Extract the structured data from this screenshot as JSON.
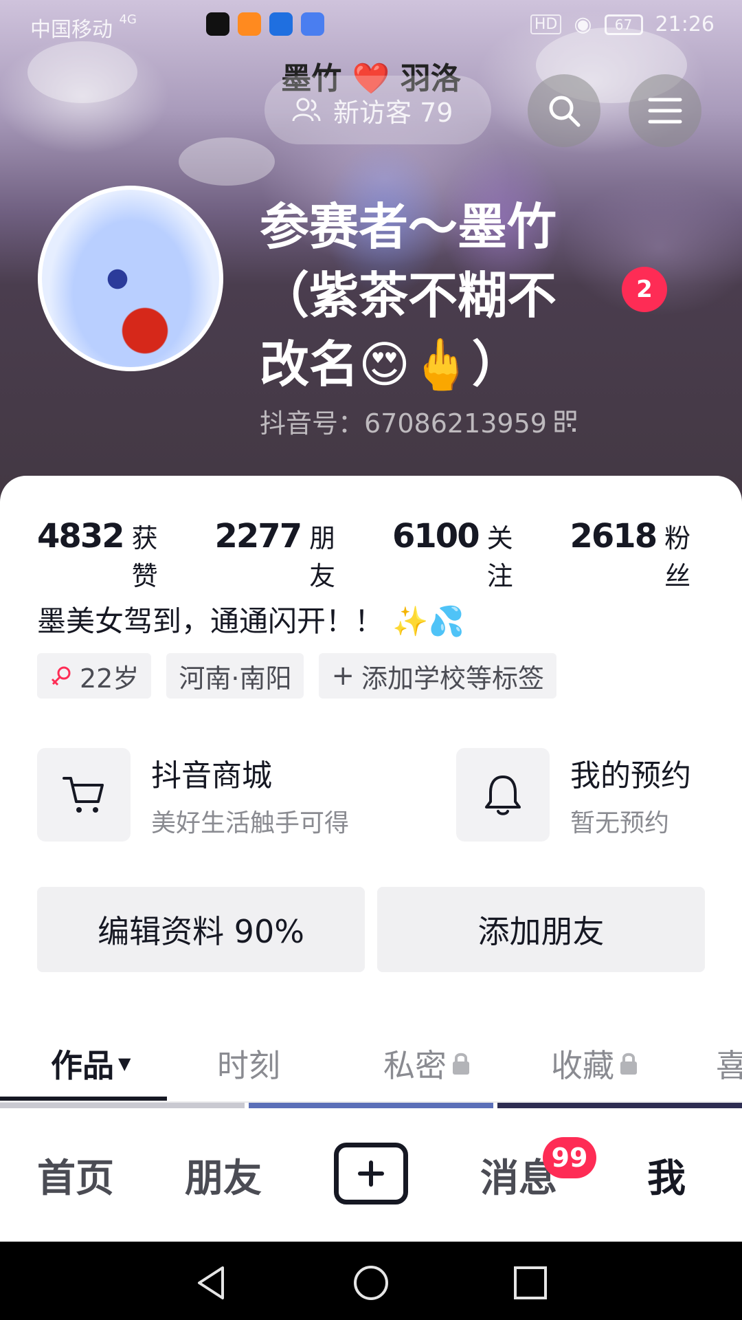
{
  "status_bar": {
    "carrier": "中国移动",
    "network": "4G",
    "battery": "67",
    "time": "21:26"
  },
  "header": {
    "cover_title": "墨竹 ❤️ 羽洛",
    "visitor_label": "新访客 79",
    "search_icon": "search-icon",
    "menu_icon": "menu-icon"
  },
  "profile": {
    "nickname": "参赛者～墨竹（紫茶不糊不改名😍🖕）",
    "notification_count": "2",
    "douyin_id": "抖音号：67086213959"
  },
  "stats": [
    {
      "value": "4832",
      "label": "获赞"
    },
    {
      "value": "2277",
      "label": "朋友"
    },
    {
      "value": "6100",
      "label": "关注"
    },
    {
      "value": "2618",
      "label": "粉丝"
    }
  ],
  "bio": "墨美女驾到，通通闪开！！ ✨💦",
  "tags": {
    "age": "22岁",
    "location": "河南·南阳",
    "add_tag": "添加学校等标签"
  },
  "entries": {
    "mall": {
      "title": "抖音商城",
      "subtitle": "美好生活触手可得"
    },
    "booking": {
      "title": "我的预约",
      "subtitle": "暂无预约"
    }
  },
  "actions": {
    "edit_profile": "编辑资料 90%",
    "add_friend": "添加朋友"
  },
  "tabs": {
    "works": "作品",
    "moments": "时刻",
    "private": "私密",
    "favorites": "收藏",
    "likes": "喜"
  },
  "bottom_nav": {
    "home": "首页",
    "friends": "朋友",
    "messages": "消息",
    "messages_badge": "99",
    "me": "我"
  },
  "colors": {
    "accent": "#fe2c55",
    "text_primary": "#161823",
    "text_secondary": "#8a8b91"
  }
}
